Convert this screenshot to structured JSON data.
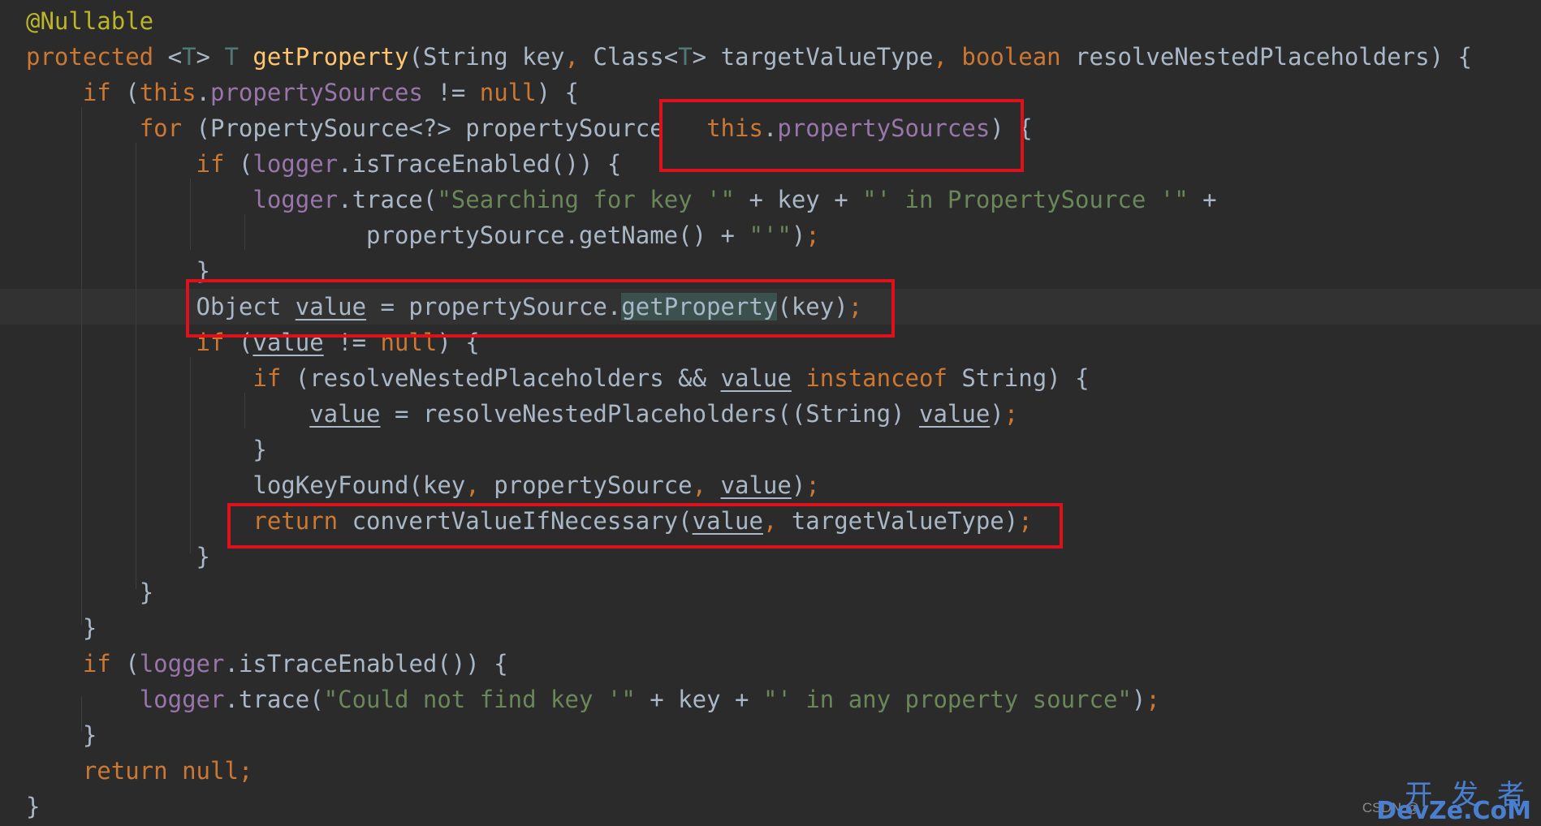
{
  "editor": {
    "lines": [
      [
        {
          "t": "@Nullable",
          "c": "annotation"
        }
      ],
      [
        {
          "t": "protected ",
          "c": "kw"
        },
        {
          "t": "<",
          "c": "plain"
        },
        {
          "t": "T",
          "c": "type"
        },
        {
          "t": "> ",
          "c": "plain"
        },
        {
          "t": "T ",
          "c": "type"
        },
        {
          "t": "getProperty",
          "c": "fn"
        },
        {
          "t": "(String key",
          "c": "plain"
        },
        {
          "t": ", ",
          "c": "punct"
        },
        {
          "t": "Class<",
          "c": "plain"
        },
        {
          "t": "T",
          "c": "type"
        },
        {
          "t": "> targetValueType",
          "c": "plain"
        },
        {
          "t": ", ",
          "c": "punct"
        },
        {
          "t": "boolean ",
          "c": "kw"
        },
        {
          "t": "resolveNestedPlaceholders) {",
          "c": "plain"
        }
      ],
      [
        {
          "t": "    "
        },
        {
          "t": "if ",
          "c": "kw"
        },
        {
          "t": "(",
          "c": "plain"
        },
        {
          "t": "this",
          "c": "kw"
        },
        {
          "t": ".",
          "c": "plain"
        },
        {
          "t": "propertySources ",
          "c": "field"
        },
        {
          "t": "!= ",
          "c": "plain"
        },
        {
          "t": "null",
          "c": "kw"
        },
        {
          "t": ") {",
          "c": "plain"
        }
      ],
      [
        {
          "t": "        "
        },
        {
          "t": "for ",
          "c": "kw"
        },
        {
          "t": "(PropertySource<?> propertySource   ",
          "c": "plain"
        },
        {
          "t": "this",
          "c": "kw"
        },
        {
          "t": ".",
          "c": "plain"
        },
        {
          "t": "propertySources",
          "c": "field"
        },
        {
          "t": ") {",
          "c": "plain"
        }
      ],
      [
        {
          "t": "            "
        },
        {
          "t": "if ",
          "c": "kw"
        },
        {
          "t": "(",
          "c": "plain"
        },
        {
          "t": "logger",
          "c": "field"
        },
        {
          "t": ".isTraceEnabled()) {",
          "c": "plain"
        }
      ],
      [
        {
          "t": "                "
        },
        {
          "t": "logger",
          "c": "field"
        },
        {
          "t": ".trace(",
          "c": "plain"
        },
        {
          "t": "\"Searching for key '\" ",
          "c": "str"
        },
        {
          "t": "+ key + ",
          "c": "plain"
        },
        {
          "t": "\"' in PropertySource '\" ",
          "c": "str"
        },
        {
          "t": "+",
          "c": "plain"
        }
      ],
      [
        {
          "t": "                        "
        },
        {
          "t": "propertySource.getName() + ",
          "c": "plain"
        },
        {
          "t": "\"'\"",
          "c": "str"
        },
        {
          "t": ")",
          "c": "plain"
        },
        {
          "t": ";",
          "c": "punct"
        }
      ],
      [
        {
          "t": "            "
        },
        {
          "t": "}",
          "c": "plain"
        }
      ],
      [
        {
          "t": "            "
        },
        {
          "t": "Object ",
          "c": "plain"
        },
        {
          "t": "value",
          "c": "plain",
          "u": true
        },
        {
          "t": " = propertySource.",
          "c": "plain"
        },
        {
          "t": "getProperty",
          "c": "plain",
          "m": true
        },
        {
          "t": "(key)",
          "c": "plain"
        },
        {
          "t": ";",
          "c": "punct"
        }
      ],
      [
        {
          "t": "            "
        },
        {
          "t": "if ",
          "c": "kw"
        },
        {
          "t": "(",
          "c": "plain"
        },
        {
          "t": "value",
          "c": "plain",
          "u": true
        },
        {
          "t": " != ",
          "c": "plain"
        },
        {
          "t": "null",
          "c": "kw"
        },
        {
          "t": ") {",
          "c": "plain"
        }
      ],
      [
        {
          "t": "                "
        },
        {
          "t": "if ",
          "c": "kw"
        },
        {
          "t": "(resolveNestedPlaceholders && ",
          "c": "plain"
        },
        {
          "t": "value",
          "c": "plain",
          "u": true
        },
        {
          "t": " ",
          "c": "plain"
        },
        {
          "t": "instanceof ",
          "c": "kw"
        },
        {
          "t": "String) {",
          "c": "plain"
        }
      ],
      [
        {
          "t": "                    "
        },
        {
          "t": "value",
          "c": "plain",
          "u": true
        },
        {
          "t": " = resolveNestedPlaceholders((String) ",
          "c": "plain"
        },
        {
          "t": "value",
          "c": "plain",
          "u": true
        },
        {
          "t": ")",
          "c": "plain"
        },
        {
          "t": ";",
          "c": "punct"
        }
      ],
      [
        {
          "t": "                "
        },
        {
          "t": "}",
          "c": "plain"
        }
      ],
      [
        {
          "t": "                "
        },
        {
          "t": "logKeyFound(key",
          "c": "plain"
        },
        {
          "t": ", ",
          "c": "punct"
        },
        {
          "t": "propertySource",
          "c": "plain"
        },
        {
          "t": ", ",
          "c": "punct"
        },
        {
          "t": "value",
          "c": "plain",
          "u": true
        },
        {
          "t": ")",
          "c": "plain"
        },
        {
          "t": ";",
          "c": "punct"
        }
      ],
      [
        {
          "t": "                "
        },
        {
          "t": "return ",
          "c": "kw"
        },
        {
          "t": "convertValueIfNecessary(",
          "c": "plain"
        },
        {
          "t": "value",
          "c": "plain",
          "u": true
        },
        {
          "t": ", ",
          "c": "punct"
        },
        {
          "t": "targetValueType)",
          "c": "plain"
        },
        {
          "t": ";",
          "c": "punct"
        }
      ],
      [
        {
          "t": "            "
        },
        {
          "t": "}",
          "c": "plain"
        }
      ],
      [
        {
          "t": "        "
        },
        {
          "t": "}",
          "c": "plain"
        }
      ],
      [
        {
          "t": "    "
        },
        {
          "t": "}",
          "c": "plain"
        }
      ],
      [
        {
          "t": "    "
        },
        {
          "t": "if ",
          "c": "kw"
        },
        {
          "t": "(",
          "c": "plain"
        },
        {
          "t": "logger",
          "c": "field"
        },
        {
          "t": ".isTraceEnabled()) {",
          "c": "plain"
        }
      ],
      [
        {
          "t": "        "
        },
        {
          "t": "logger",
          "c": "field"
        },
        {
          "t": ".trace(",
          "c": "plain"
        },
        {
          "t": "\"Could not find key '\" ",
          "c": "str"
        },
        {
          "t": "+ key + ",
          "c": "plain"
        },
        {
          "t": "\"' in any property source\"",
          "c": "str"
        },
        {
          "t": ")",
          "c": "plain"
        },
        {
          "t": ";",
          "c": "punct"
        }
      ],
      [
        {
          "t": "    "
        },
        {
          "t": "}",
          "c": "plain"
        }
      ],
      [
        {
          "t": "    "
        },
        {
          "t": "return ",
          "c": "kw"
        },
        {
          "t": "null",
          "c": "kw"
        },
        {
          "t": ";",
          "c": "punct"
        }
      ],
      [
        {
          "t": "}",
          "c": "plain"
        }
      ]
    ]
  },
  "watermark": {
    "csdn": "CSDN @",
    "site_cn": "开 发 者",
    "site_en": "DevZe.CoM"
  },
  "colors": {
    "background": "#2b2b2b",
    "caret_row": "#323232",
    "highlight_box": "#e0101a",
    "keyword": "#cc7832",
    "annotation": "#bbb529",
    "function": "#ffc66d",
    "field": "#9876aa",
    "string": "#6a8759",
    "plain": "#a9b7c6"
  }
}
